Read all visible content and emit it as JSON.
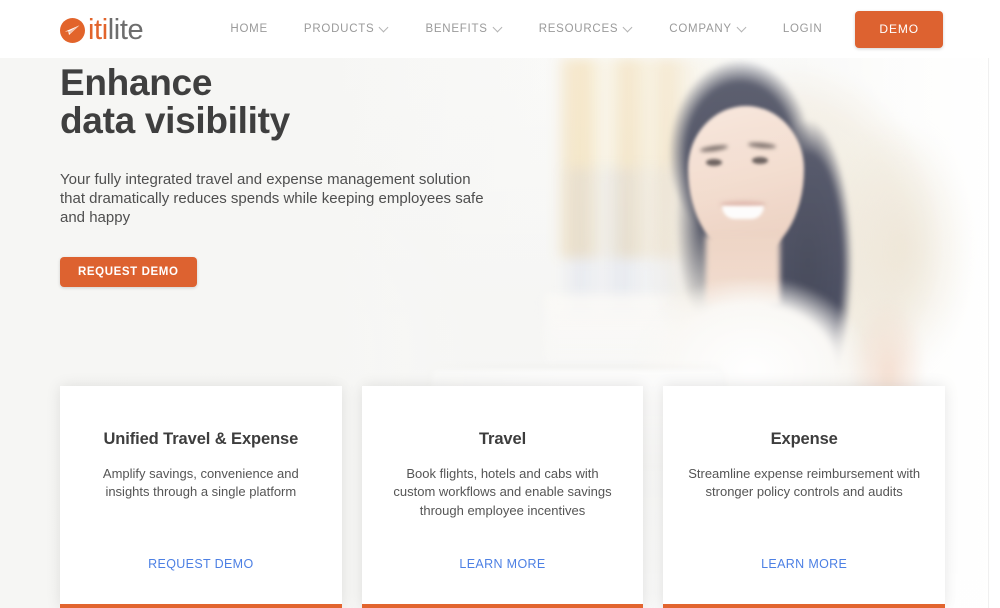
{
  "brand": {
    "name_part_one": "iti",
    "name_part_two": "lite",
    "logo_icon": "paper-plane-circle-icon",
    "accent_color": "#dd6230",
    "logo_orange": "#e2642b",
    "logo_gray": "#6d6d6d"
  },
  "header": {
    "nav_items": [
      {
        "label": "HOME",
        "has_dropdown": false
      },
      {
        "label": "PRODUCTS",
        "has_dropdown": true
      },
      {
        "label": "BENEFITS",
        "has_dropdown": true
      },
      {
        "label": "RESOURCES",
        "has_dropdown": true
      },
      {
        "label": "COMPANY",
        "has_dropdown": true
      },
      {
        "label": "LOGIN",
        "has_dropdown": false
      }
    ],
    "demo_button_label": "DEMO"
  },
  "hero": {
    "title_line_one": "Enhance",
    "title_line_two": "data visibility",
    "subtitle": "Your fully integrated travel and expense management solution that dramatically reduces spends while keeping employees safe and happy",
    "cta_label": "REQUEST DEMO",
    "background_image_description": "Smiling woman with long dark hair in a white top working at a laptop in a bright office"
  },
  "cards": [
    {
      "title": "Unified Travel & Expense",
      "description": "Amplify savings, convenience and insights through a single platform",
      "link_label": "REQUEST DEMO",
      "accent_color": "#e2652f",
      "link_color": "#4d80e4"
    },
    {
      "title": "Travel",
      "description": "Book flights, hotels and cabs with custom workflows and enable savings through employee incentives",
      "link_label": "LEARN MORE",
      "accent_color": "#e2652f",
      "link_color": "#4d80e4"
    },
    {
      "title": "Expense",
      "description": "Streamline expense reimbursement with stronger policy controls and audits",
      "link_label": "LEARN MORE",
      "accent_color": "#e2652f",
      "link_color": "#4d80e4"
    }
  ]
}
